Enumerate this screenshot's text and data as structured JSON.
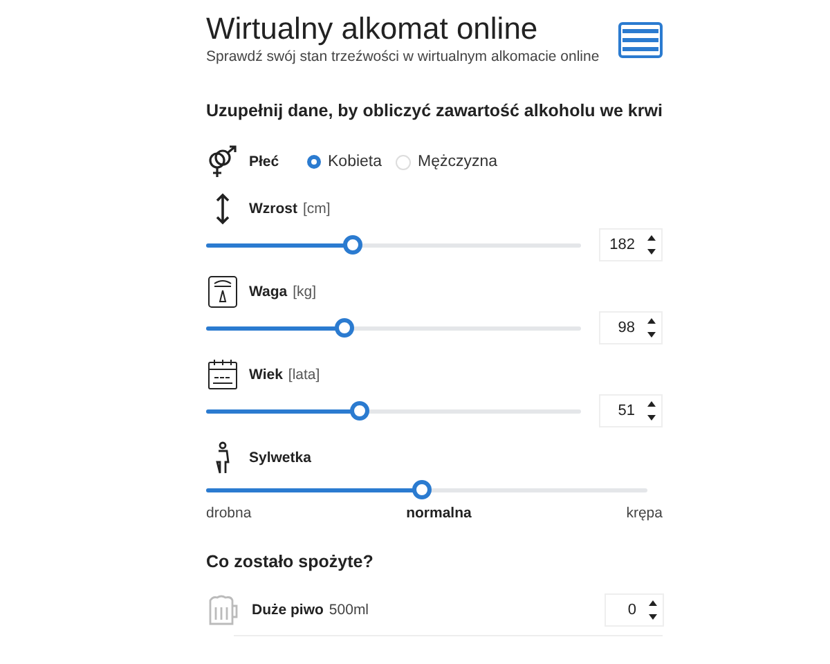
{
  "header": {
    "title": "Wirtualny alkomat online",
    "subtitle": "Sprawdź swój stan trzeźwości w wirtualnym alkomacie online"
  },
  "form_heading": "Uzupełnij dane, by obliczyć zawartość alkoholu we krwi",
  "gender": {
    "label": "Płeć",
    "options": [
      {
        "label": "Kobieta",
        "selected": true
      },
      {
        "label": "Mężczyzna",
        "selected": false
      }
    ]
  },
  "measures": [
    {
      "kind": "height",
      "label": "Wzrost",
      "unit": "[cm]",
      "level": 0.39,
      "value": "182"
    },
    {
      "kind": "scale",
      "label": "Waga",
      "unit": "[kg]",
      "level": 0.37,
      "value": "98"
    },
    {
      "kind": "calendar",
      "label": "Wiek",
      "unit": "[lata]",
      "level": 0.41,
      "value": "51"
    }
  ],
  "figure": {
    "label": "Sylwetka",
    "level": 0.49,
    "options": [
      {
        "label": "drobna",
        "selected": false
      },
      {
        "label": "normalna",
        "selected": true
      },
      {
        "label": "krępa",
        "selected": false
      }
    ]
  },
  "drinks_heading": "Co zostało spożyte?",
  "drinks": [
    {
      "label": "Duże piwo",
      "unit": "500ml",
      "value": "0"
    }
  ]
}
